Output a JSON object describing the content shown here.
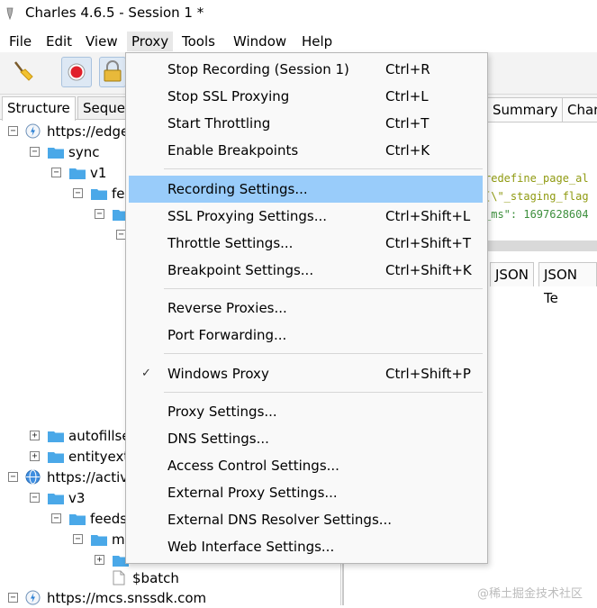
{
  "window": {
    "title": "Charles 4.6.5 - Session 1 *"
  },
  "menubar": [
    "File",
    "Edit",
    "View",
    "Proxy",
    "Tools",
    "Window",
    "Help"
  ],
  "left_tabs": [
    "Structure",
    "Seque"
  ],
  "tree": [
    "https://edge",
    "sync",
    "v1",
    "fe",
    "autofillse",
    "entityext",
    "https://activ",
    "v3",
    "feeds",
    "m",
    "$batch",
    "https://mcs.snssdk.com"
  ],
  "right_tabs_top": [
    "Summary",
    "Char"
  ],
  "right_tabs_bottom": [
    "JSON",
    "JSON Te"
  ],
  "code_lines": [
    "redefine_page_al",
    "[\\\"_staging_flag",
    "_ms\": 1697628604"
  ],
  "proxy_menu": {
    "items": [
      {
        "label": "Stop Recording (Session 1)",
        "shortcut": "Ctrl+R"
      },
      {
        "label": "Stop SSL Proxying",
        "shortcut": "Ctrl+L"
      },
      {
        "label": "Start Throttling",
        "shortcut": "Ctrl+T"
      },
      {
        "label": "Enable Breakpoints",
        "shortcut": "Ctrl+K"
      },
      {
        "label": "Recording Settings...",
        "shortcut": ""
      },
      {
        "label": "SSL Proxying Settings...",
        "shortcut": "Ctrl+Shift+L"
      },
      {
        "label": "Throttle Settings...",
        "shortcut": "Ctrl+Shift+T"
      },
      {
        "label": "Breakpoint Settings...",
        "shortcut": "Ctrl+Shift+K"
      },
      {
        "label": "Reverse Proxies...",
        "shortcut": ""
      },
      {
        "label": "Port Forwarding...",
        "shortcut": ""
      },
      {
        "label": "Windows Proxy",
        "shortcut": "Ctrl+Shift+P",
        "check": "✓"
      },
      {
        "label": "Proxy Settings...",
        "shortcut": ""
      },
      {
        "label": "DNS Settings...",
        "shortcut": ""
      },
      {
        "label": "Access Control Settings...",
        "shortcut": ""
      },
      {
        "label": "External Proxy Settings...",
        "shortcut": ""
      },
      {
        "label": "External DNS Resolver Settings...",
        "shortcut": ""
      },
      {
        "label": "Web Interface Settings...",
        "shortcut": ""
      }
    ]
  },
  "watermark": "@稀土掘金技术社区",
  "colors": {
    "menu_highlight": "#99ccfa",
    "folder": "#4aa8e8",
    "code_olive": "#8f9a10",
    "code_green": "#3d8f3d",
    "record_red": "#e0202a"
  }
}
